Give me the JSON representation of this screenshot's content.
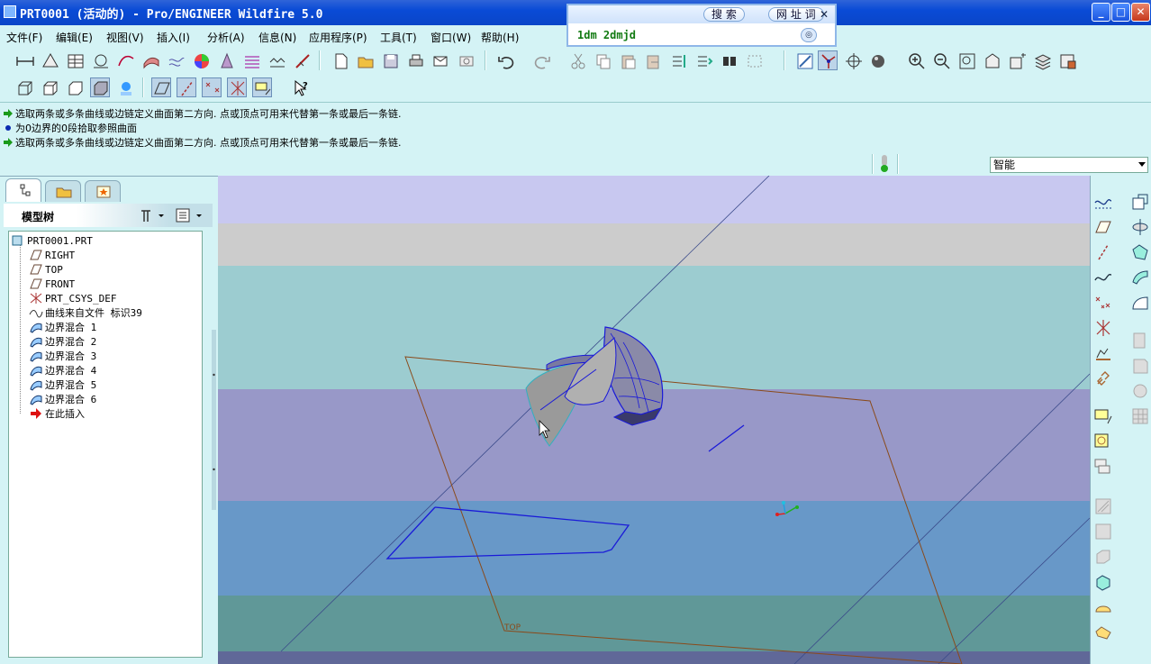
{
  "window": {
    "title": "PRT0001 (活动的) - Pro/ENGINEER Wildfire 5.0",
    "buttons": {
      "minimize": "_",
      "maximize": "□",
      "close": "✕"
    }
  },
  "search_popup": {
    "tab_search": "搜 索",
    "tab_url": "网 址 词",
    "query": "1dm 2dmjd",
    "close": "✕"
  },
  "menu": [
    "文件(F)",
    "编辑(E)",
    "视图(V)",
    "插入(I)",
    "分析(A)",
    "信息(N)",
    "应用程序(P)",
    "工具(T)",
    "窗口(W)",
    "帮助(H)"
  ],
  "messages": [
    {
      "type": "prompt",
      "text": "选取两条或多条曲线或边链定义曲面第二方向. 点或顶点可用来代替第一条或最后一条链."
    },
    {
      "type": "info",
      "text": "为0边界的0段拾取参照曲面"
    },
    {
      "type": "prompt",
      "text": "选取两条或多条曲线或边链定义曲面第二方向. 点或顶点可用来代替第一条或最后一条链."
    }
  ],
  "selection_filter": {
    "value": "智能"
  },
  "navigator": {
    "tree_title": "模型树",
    "items": [
      {
        "label": "PRT0001.PRT",
        "icon": "part-icon"
      },
      {
        "label": "RIGHT",
        "icon": "datum-plane-icon"
      },
      {
        "label": "TOP",
        "icon": "datum-plane-icon"
      },
      {
        "label": "FRONT",
        "icon": "datum-plane-icon"
      },
      {
        "label": "PRT_CSYS_DEF",
        "icon": "csys-icon"
      },
      {
        "label": "曲线来自文件 标识39",
        "icon": "curve-icon"
      },
      {
        "label": "边界混合 1",
        "icon": "boundary-blend-icon"
      },
      {
        "label": "边界混合 2",
        "icon": "boundary-blend-icon"
      },
      {
        "label": "边界混合 3",
        "icon": "boundary-blend-icon"
      },
      {
        "label": "边界混合 4",
        "icon": "boundary-blend-icon"
      },
      {
        "label": "边界混合 5",
        "icon": "boundary-blend-icon"
      },
      {
        "label": "边界混合 6",
        "icon": "boundary-blend-icon"
      },
      {
        "label": "在此插入",
        "icon": "insert-here-arrow-icon"
      }
    ]
  },
  "graphics": {
    "datum_label": "TOP",
    "band_colors": [
      "#c8c8f0",
      "#cccccc",
      "#9cccd0",
      "#9898c8",
      "#6898c8",
      "#609898",
      "#606898"
    ]
  }
}
